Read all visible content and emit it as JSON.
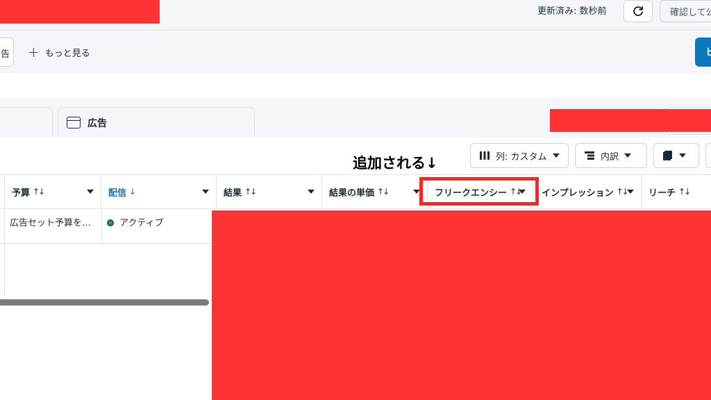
{
  "topbar": {
    "updated_text": "更新済み: 数秒前",
    "refresh_icon": "refresh-icon",
    "confirm_label": "確認して公"
  },
  "secondbar": {
    "partial_button_label": "告",
    "more_label": "もっと見る",
    "blue_button_label": "ヒ"
  },
  "tabs": {
    "ads_label": "広告"
  },
  "toolbar": {
    "columns_label": "列: カスタム",
    "breakdown_label": "内訳"
  },
  "annotation": {
    "text": "追加される↓"
  },
  "table": {
    "columns": [
      {
        "label": "予算",
        "sort": "↑↓"
      },
      {
        "label": "配信",
        "sort": "↓"
      },
      {
        "label": "結果",
        "sort": "↑↓"
      },
      {
        "label": "結果の単価",
        "sort": "↑↓"
      },
      {
        "label": "フリークエンシー",
        "sort": "↑↓"
      },
      {
        "label": "インプレッション",
        "sort": "↑↓"
      },
      {
        "label": "リーチ",
        "sort": "↑↓"
      }
    ],
    "rows": [
      {
        "budget": "広告セット予算を…",
        "delivery": "アクティブ"
      }
    ]
  },
  "colors": {
    "accent": "#0a78be",
    "active_status": "#31a24c",
    "redaction": "#ff3333",
    "highlight": "#ff2222"
  }
}
